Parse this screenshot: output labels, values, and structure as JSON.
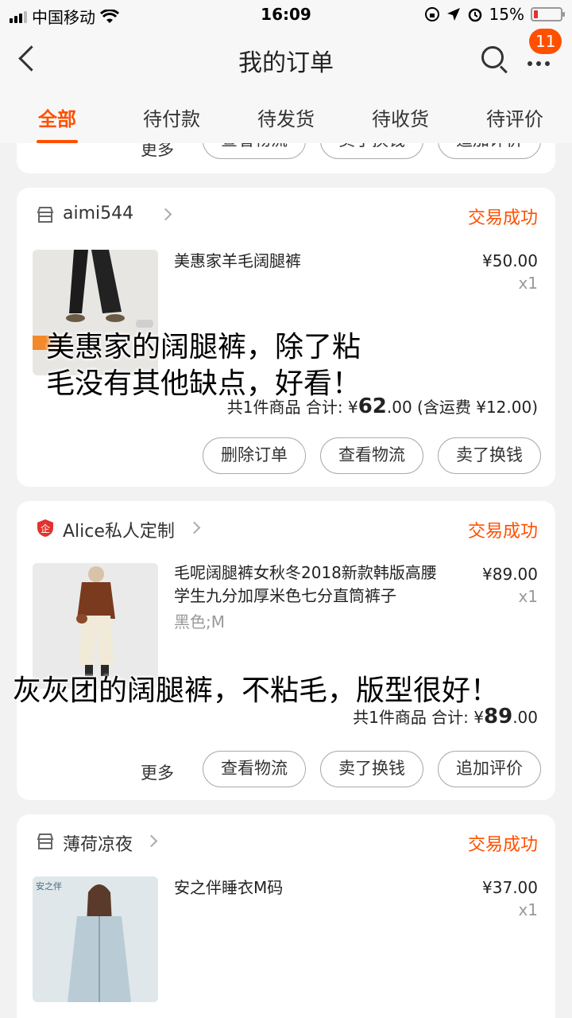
{
  "status_bar": {
    "carrier": "中国移动",
    "time": "16:09",
    "battery": "15%"
  },
  "nav": {
    "title": "我的订单",
    "badge": "11"
  },
  "tabs": [
    "全部",
    "待付款",
    "待发货",
    "待收货",
    "待评价"
  ],
  "top_partial_card": {
    "more": "更多",
    "buttons": [
      "查看物流",
      "卖了换钱",
      "追加评价"
    ]
  },
  "orders": [
    {
      "shop": "aimi544",
      "status": "交易成功",
      "product": "美惠家羊毛阔腿裤",
      "sku": "",
      "price": "¥50.00",
      "qty": "x1",
      "summary_prefix": "共1件商品 合计: ¥",
      "summary_big": "62",
      "summary_suffix": ".00 (含运费 ¥12.00)",
      "buttons": [
        "删除订单",
        "查看物流",
        "卖了换钱"
      ]
    },
    {
      "shop": "Alice私人定制",
      "status": "交易成功",
      "product": "毛呢阔腿裤女秋冬2018新款韩版高腰学生九分加厚米色七分直筒裤子",
      "sku": "黑色;M",
      "price": "¥89.00",
      "qty": "x1",
      "summary_prefix": "共1件商品 合计: ¥",
      "summary_big": "89",
      "summary_suffix": ".00",
      "more": "更多",
      "buttons": [
        "查看物流",
        "卖了换钱",
        "追加评价"
      ]
    },
    {
      "shop": "薄荷凉夜",
      "status": "交易成功",
      "product": "安之伴睡衣M码",
      "price": "¥37.00",
      "qty": "x1",
      "thumb_brand": "安之伴"
    }
  ],
  "overlays": {
    "caption1_line1": "美惠家的阔腿裤，除了粘",
    "caption1_line2": "毛没有其他缺点，好看！",
    "caption2": "灰灰团的阔腿裤，不粘毛，版型很好！"
  },
  "colors": {
    "accent": "#ff5000",
    "background": "#f2f2f2",
    "card": "#ffffff"
  }
}
